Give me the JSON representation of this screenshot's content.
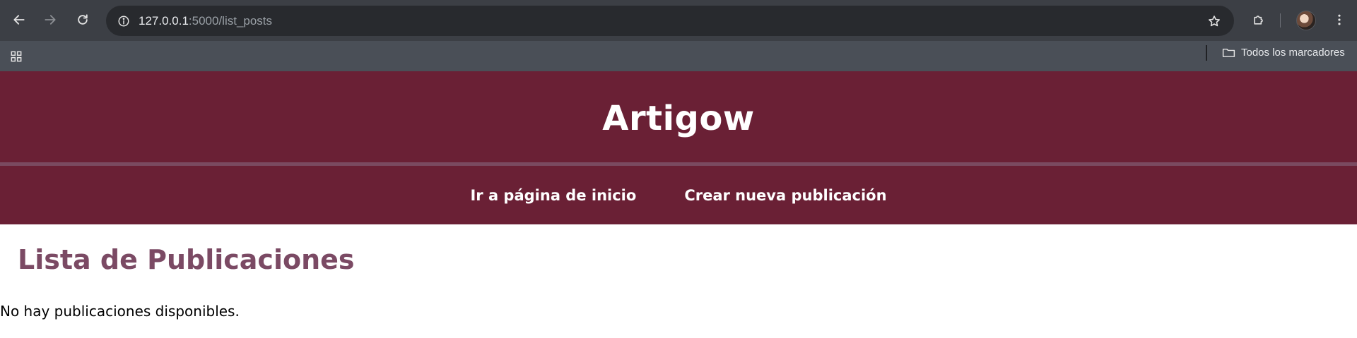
{
  "browser": {
    "url": {
      "host": "127.0.0.1",
      "rest": ":5000/list_posts"
    },
    "icons": {
      "back": "arrow-back-icon",
      "forward": "arrow-forward-icon",
      "reload": "reload-icon",
      "site_info": "site-info-icon",
      "bookmark_star": "star-icon",
      "extensions": "puzzle-icon",
      "menu": "more-vertical-icon",
      "apps": "apps-grid-icon",
      "folder": "folder-icon"
    },
    "bookmarks_bar": {
      "all_bookmarks_label": "Todos los marcadores"
    }
  },
  "site": {
    "title": "Artigow",
    "nav": {
      "home_label": "Ir a página de inicio",
      "new_post_label": "Crear nueva publicación"
    },
    "colors": {
      "header_bg": "#6a2035",
      "heading": "#7b4a64"
    }
  },
  "main": {
    "heading": "Lista de Publicaciones",
    "empty_message": "No hay publicaciones disponibles."
  }
}
